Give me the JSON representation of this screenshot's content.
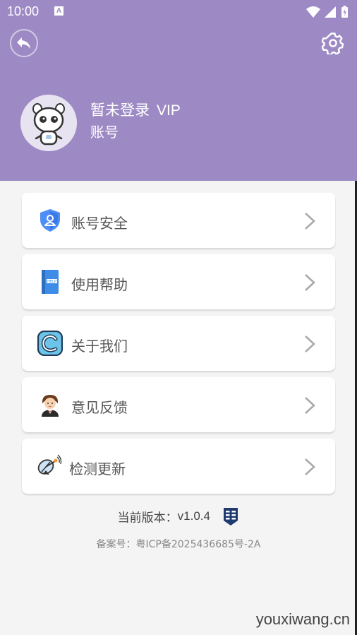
{
  "status_bar": {
    "time": "10:00",
    "notification_glyph": "A"
  },
  "header": {
    "background_color": "#9d8ac5",
    "user_name": "暂未登录",
    "vip_label": "VIP",
    "account_label": "账号"
  },
  "menu": {
    "items": [
      {
        "label": "账号安全",
        "icon": "shield-user-icon"
      },
      {
        "label": "使用帮助",
        "icon": "help-book-icon"
      },
      {
        "label": "关于我们",
        "icon": "c-logo-icon"
      },
      {
        "label": "意见反馈",
        "icon": "service-agent-icon"
      },
      {
        "label": "检测更新",
        "icon": "satellite-icon"
      }
    ]
  },
  "version": {
    "prefix": "当前版本：",
    "number": "v1.0.4"
  },
  "icp": "备案号：粤ICP备2025436685号-2A",
  "watermark": "youxiwang.cn"
}
